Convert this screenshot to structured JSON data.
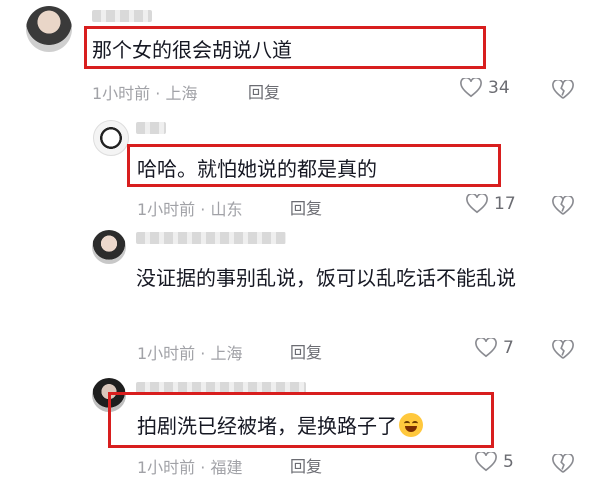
{
  "comments": [
    {
      "text": "那个女的很会胡说八道",
      "meta": "1小时前 · 上海",
      "reply": "回复",
      "likes": "34"
    },
    {
      "text": "哈哈。就怕她说的都是真的",
      "meta": "1小时前 · 山东",
      "reply": "回复",
      "likes": "17"
    },
    {
      "text": "没证据的事别乱说，饭可以乱吃话不能乱说",
      "meta": "1小时前 · 上海",
      "reply": "回复",
      "likes": "7"
    },
    {
      "text": "拍剧洗已经被堵，是换路子了",
      "meta": "1小时前 · 福建",
      "reply": "回复",
      "likes": "5"
    }
  ],
  "icons": {
    "like": "heart-outline-icon",
    "dislike": "broken-heart-icon",
    "emoji": "laughing-face-emoji"
  },
  "colors": {
    "highlight_box": "#d81e1e",
    "meta_text": "#a1a2a7",
    "body_text": "#161823"
  }
}
